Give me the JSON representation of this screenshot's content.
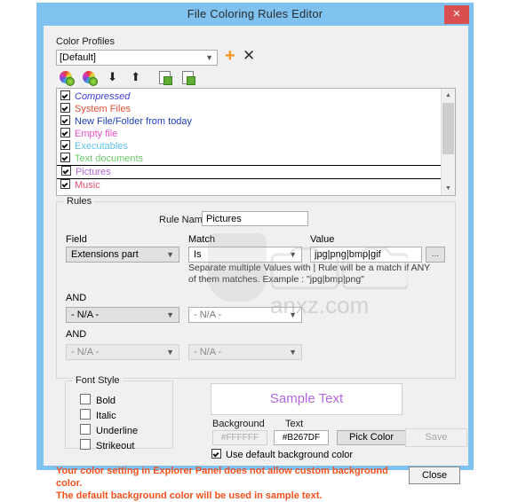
{
  "window": {
    "title": "File Coloring Rules Editor",
    "close_icon": "close-x",
    "accent": "#7FC2F0",
    "close_button_color": "#D94F4F"
  },
  "color_profiles": {
    "label": "Color Profiles",
    "selected": "[Default]",
    "add_label": "+",
    "remove_label": "✕",
    "toolbar": [
      {
        "name": "add-color-icon",
        "glyph": "wheel"
      },
      {
        "name": "edit-color-icon",
        "glyph": "wheel"
      },
      {
        "name": "move-down-icon",
        "glyph": "↓"
      },
      {
        "name": "move-up-icon",
        "glyph": "↑"
      },
      {
        "name": "import-profile-icon",
        "glyph": "doc"
      },
      {
        "name": "export-profile-icon",
        "glyph": "doc"
      }
    ]
  },
  "rules_list": {
    "items": [
      {
        "label": "Compressed",
        "checked": true,
        "color": "#3B3BD6",
        "italic": true,
        "selected": false
      },
      {
        "label": "System Files",
        "checked": true,
        "color": "#E0503A",
        "italic": false,
        "selected": false
      },
      {
        "label": "New File/Folder from today",
        "checked": true,
        "color": "#1F3FBF",
        "italic": false,
        "selected": false
      },
      {
        "label": "Empty file",
        "checked": true,
        "color": "#F050C8",
        "italic": false,
        "selected": false
      },
      {
        "label": "Executables",
        "checked": true,
        "color": "#5BC2E8",
        "italic": false,
        "selected": false
      },
      {
        "label": "Text documents",
        "checked": true,
        "color": "#6ECB6E",
        "italic": false,
        "selected": false
      },
      {
        "label": "Pictures",
        "checked": true,
        "color": "#B267DF",
        "italic": false,
        "selected": true
      },
      {
        "label": "Music",
        "checked": true,
        "color": "#E2506E",
        "italic": false,
        "selected": false
      }
    ]
  },
  "rules": {
    "group_title": "Rules",
    "rule_name_label": "Rule Name",
    "rule_name_value": "Pictures",
    "field_header": "Field",
    "match_header": "Match",
    "value_header": "Value",
    "browse_label": "...",
    "row1": {
      "field": "Extensions part",
      "match": "Is",
      "value": "jpg|png|bmp|gif"
    },
    "and1_label": "AND",
    "row2": {
      "field": "- N/A -",
      "match": "- N/A -"
    },
    "and2_label": "AND",
    "row3": {
      "field": "- N/A -",
      "match": "- N/A -"
    },
    "hint": "Separate multiple Values with | Rule will be a match if ANY of them matches. Example : \"jpg|bmp|png\""
  },
  "font_style": {
    "group_title": "Font Style",
    "options": [
      {
        "label": "Bold",
        "checked": false
      },
      {
        "label": "Italic",
        "checked": false
      },
      {
        "label": "Underline",
        "checked": false
      },
      {
        "label": "Strikeout",
        "checked": false
      }
    ]
  },
  "preview": {
    "sample_text": "Sample Text",
    "sample_color": "#B267DF",
    "background_label": "Background",
    "text_label": "Text",
    "background_value": "#FFFFFF",
    "text_value": "#B267DF",
    "pick_color_label": "Pick Color",
    "use_default_label": "Use default background color",
    "use_default_checked": true,
    "save_label": "Save"
  },
  "footer": {
    "warning_line1": "Your color setting in Explorer Panel does not allow custom background color.",
    "warning_line2": "The default background color will be used in sample text.",
    "warning_color": "#F4511E",
    "close_label": "Close"
  },
  "watermark": {
    "text": "anxz.com"
  }
}
